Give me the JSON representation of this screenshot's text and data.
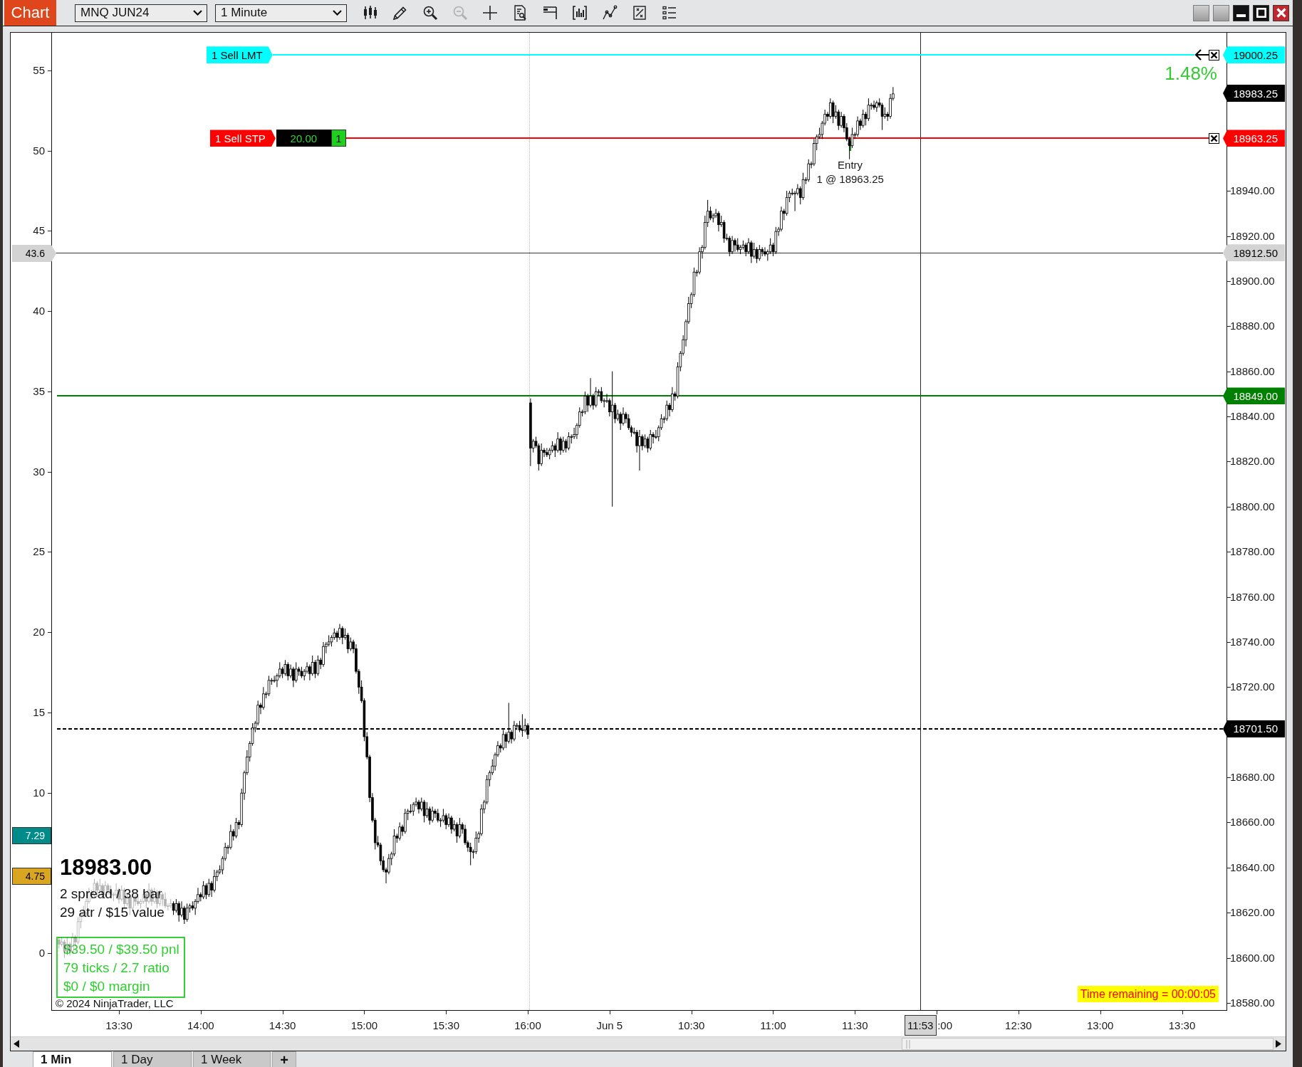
{
  "window": {
    "title": "Chart"
  },
  "toolbar": {
    "instrument": "MNQ JUN24",
    "interval": "1 Minute",
    "tools": [
      {
        "kind": "candles",
        "disabled": false
      },
      {
        "kind": "pencil",
        "disabled": false
      },
      {
        "kind": "zoom_in",
        "disabled": false
      },
      {
        "kind": "zoom_out",
        "disabled": true
      },
      {
        "kind": "crosshair",
        "disabled": false
      },
      {
        "kind": "document_search",
        "disabled": false
      },
      {
        "kind": "rows",
        "disabled": false
      },
      {
        "kind": "bar_chart",
        "disabled": false
      },
      {
        "kind": "line_chart",
        "disabled": false
      },
      {
        "kind": "square_chart",
        "disabled": false
      },
      {
        "kind": "list",
        "disabled": false
      }
    ]
  },
  "chart": {
    "chart_data": {
      "type": "candlestick",
      "ylim": [
        18576.5,
        19010.1
      ],
      "yticks": [
        {
          "value": 18940,
          "label": "18940.00"
        },
        {
          "value": 18920,
          "label": "18920.00"
        },
        {
          "value": 18900,
          "label": "18900.00"
        },
        {
          "value": 18880,
          "label": "18880.00"
        },
        {
          "value": 18860,
          "label": "18860.00"
        },
        {
          "value": 18840,
          "label": "18840.00"
        },
        {
          "value": 18820,
          "label": "18820.00"
        },
        {
          "value": 18800,
          "label": "18800.00"
        },
        {
          "value": 18780,
          "label": "18780.00"
        },
        {
          "value": 18760,
          "label": "18760.00"
        },
        {
          "value": 18740,
          "label": "18740.00"
        },
        {
          "value": 18720,
          "label": "18720.00"
        },
        {
          "value": 18680,
          "label": "18680.00"
        },
        {
          "value": 18660,
          "label": "18660.00"
        },
        {
          "value": 18640,
          "label": "18640.00"
        },
        {
          "value": 18620,
          "label": "18620.00"
        },
        {
          "value": 18600,
          "label": "18600.00"
        },
        {
          "value": 18580,
          "label": "18580.00"
        }
      ],
      "ref_lines": [
        {
          "axis": "y",
          "value": 19000.25,
          "color": "#00ffff"
        },
        {
          "axis": "y",
          "value": 18963.25,
          "color": "#ff0000"
        },
        {
          "axis": "y",
          "value": 18912.5,
          "color": "#3a3a3a"
        },
        {
          "axis": "y",
          "value": 18849,
          "color": "#008000"
        },
        {
          "axis": "y",
          "value": 18701.5,
          "color": "#000000"
        }
      ],
      "categories": [
        null,
        null,
        null,
        null,
        null,
        null,
        null,
        null,
        null,
        null,
        null,
        null,
        null,
        null,
        null,
        null,
        null,
        null,
        null,
        null,
        null,
        null,
        "13:30",
        null,
        null,
        null,
        null,
        null,
        null,
        null,
        null,
        null,
        null,
        null,
        null,
        null,
        null,
        null,
        null,
        null,
        null,
        null,
        null,
        null,
        null,
        null,
        null,
        null,
        null,
        null,
        null,
        null,
        "14:00",
        null,
        null,
        null,
        null,
        null,
        null,
        null,
        null,
        null,
        null,
        null,
        null,
        null,
        null,
        null,
        null,
        null,
        null,
        null,
        null,
        null,
        null,
        null,
        null,
        null,
        null,
        null,
        null,
        null,
        "14:30",
        null,
        null,
        null,
        null,
        null,
        null,
        null,
        null,
        null,
        null,
        null,
        null,
        null,
        null,
        null,
        null,
        null,
        null,
        null,
        null,
        null,
        null,
        null,
        null,
        null,
        null,
        null,
        null,
        null,
        "15:00",
        null,
        null,
        null,
        null,
        null,
        null,
        null,
        null,
        null,
        null,
        null,
        null,
        null,
        null,
        null,
        null,
        null,
        null,
        null,
        null,
        null,
        null,
        null,
        null,
        null,
        null,
        null,
        null,
        null,
        "15:30",
        null,
        null,
        null,
        null,
        null,
        null,
        null,
        null,
        null,
        null,
        null,
        null,
        null,
        null,
        null,
        null,
        null,
        null,
        null,
        null,
        null,
        null,
        null,
        null,
        null,
        null,
        null,
        null,
        null,
        "16:00",
        null,
        null,
        null,
        null,
        null,
        null,
        null,
        null,
        null,
        null,
        null,
        null,
        null,
        null,
        null,
        null,
        null,
        null,
        null,
        null,
        null,
        null,
        null,
        null,
        null,
        null,
        null,
        null,
        null,
        "Jun 5",
        null,
        null,
        null,
        null,
        null,
        null,
        null,
        null,
        null,
        null,
        null,
        null,
        null,
        null,
        null,
        null,
        null,
        null,
        null,
        null,
        null,
        null,
        null,
        null,
        null,
        null,
        null,
        null,
        null,
        "10:30",
        null,
        null,
        null,
        null,
        null,
        null,
        null,
        null,
        null,
        null,
        null,
        null,
        null,
        null,
        null,
        null,
        null,
        null,
        null,
        null,
        null,
        null,
        null,
        null,
        null,
        null,
        null,
        null,
        null,
        "11:00",
        null,
        null,
        null,
        null,
        null,
        null,
        null,
        null,
        null,
        null,
        null,
        null,
        null,
        null,
        null,
        null,
        null,
        null,
        null,
        null,
        null,
        null,
        null,
        null,
        null,
        null,
        null,
        null,
        null,
        "11:30",
        null,
        null,
        null,
        null,
        null,
        null,
        null,
        null,
        null,
        null,
        null,
        null,
        null,
        null,
        null,
        null,
        null,
        null,
        null,
        null,
        null,
        null,
        null,
        null,
        null,
        null,
        null,
        null,
        null,
        null,
        null,
        null,
        ":00",
        null,
        null,
        null,
        null,
        null,
        null,
        null,
        null,
        null,
        null,
        null,
        null,
        null,
        null,
        null,
        null,
        null,
        null,
        null,
        null,
        null,
        null,
        null,
        null,
        null,
        null,
        "12:30",
        null,
        null,
        null,
        null,
        null,
        null,
        null,
        null,
        null,
        null,
        null,
        null,
        null,
        null,
        null,
        null,
        null,
        null,
        null,
        null,
        null,
        null,
        null,
        null,
        null,
        null,
        null,
        null,
        null,
        "13:00",
        null,
        null,
        null,
        null,
        null,
        null,
        null,
        null,
        null,
        null,
        null,
        null,
        null,
        null,
        null,
        null,
        null,
        null,
        null,
        null,
        null,
        null,
        null,
        null,
        null,
        null,
        null,
        null,
        null,
        "13:30"
      ],
      "ohlc": [
        [
          18608,
          18609,
          18604,
          18606
        ],
        [
          18606,
          18609,
          18605,
          18607
        ],
        [
          18607,
          18608,
          18600,
          18603
        ],
        [
          18603,
          18609,
          18602,
          18606
        ],
        [
          18606,
          18607,
          18601,
          18603
        ],
        [
          18603,
          18611,
          18602,
          18609
        ],
        [
          18609,
          18610,
          18605,
          18607
        ],
        [
          18607,
          18618,
          18606,
          18616
        ],
        [
          18616,
          18620,
          18613,
          18619
        ],
        [
          18619,
          18623,
          18618,
          18620
        ],
        [
          18620,
          18626,
          18618,
          18625
        ],
        [
          18625,
          18631,
          18624,
          18629
        ],
        [
          18629,
          18630,
          18626,
          18628
        ],
        [
          18628,
          18635,
          18627,
          18633
        ],
        [
          18633,
          18634,
          18627,
          18630
        ],
        [
          18630,
          18635,
          18629,
          18632
        ],
        [
          18632,
          18633,
          18626,
          18628
        ],
        [
          18628,
          18634,
          18627,
          18632
        ],
        [
          18632,
          18633,
          18628,
          18630
        ],
        [
          18630,
          18632,
          18627,
          18628
        ],
        [
          18628,
          18629,
          18625,
          18628
        ],
        [
          18628,
          18633,
          18627,
          18630
        ],
        [
          18630,
          18631,
          18624,
          18626
        ],
        [
          18626,
          18632,
          18625,
          18630
        ],
        [
          18630,
          18631,
          18622,
          18624
        ],
        [
          18624,
          18629,
          18623,
          18627
        ],
        [
          18627,
          18628,
          18619,
          18622
        ],
        [
          18622,
          18630,
          18621,
          18627
        ],
        [
          18627,
          18628,
          18623,
          18625
        ],
        [
          18625,
          18627,
          18623,
          18624
        ],
        [
          18624,
          18626,
          18622,
          18625
        ],
        [
          18625,
          18630,
          18624,
          18628
        ],
        [
          18628,
          18629,
          18622,
          18625
        ],
        [
          18625,
          18633,
          18624,
          18630
        ],
        [
          18630,
          18631,
          18623,
          18625
        ],
        [
          18625,
          18631,
          18624,
          18629
        ],
        [
          18629,
          18630,
          18622,
          18624
        ],
        [
          18624,
          18630,
          18623,
          18628
        ],
        [
          18628,
          18629,
          18623,
          18626
        ],
        [
          18626,
          18629,
          18622,
          18623
        ],
        [
          18623,
          18624,
          18621,
          18623
        ],
        [
          18623,
          18626,
          18622,
          18624
        ],
        [
          18624,
          18625,
          18619,
          18621
        ],
        [
          18621,
          18626,
          18620,
          18624
        ],
        [
          18624,
          18625,
          18616,
          18619
        ],
        [
          18619,
          18625,
          18618,
          18622
        ],
        [
          18622,
          18623,
          18615,
          18617
        ],
        [
          18617,
          18624,
          18616,
          18622
        ],
        [
          18622,
          18624,
          18620,
          18623
        ],
        [
          18623,
          18625,
          18621,
          18622
        ],
        [
          18622,
          18626,
          18619,
          18625
        ],
        [
          18625,
          18631,
          18624,
          18628
        ],
        [
          18628,
          18629,
          18625,
          18627
        ],
        [
          18627,
          18634,
          18626,
          18632
        ],
        [
          18632,
          18633,
          18626,
          18628
        ],
        [
          18628,
          18635,
          18627,
          18633
        ],
        [
          18633,
          18634,
          18627,
          18630
        ],
        [
          18630,
          18639,
          18629,
          18636
        ],
        [
          18636,
          18639,
          18634,
          18638
        ],
        [
          18638,
          18641,
          18637,
          18639
        ],
        [
          18639,
          18645,
          18637,
          18644
        ],
        [
          18644,
          18651,
          18643,
          18649
        ],
        [
          18649,
          18650,
          18646,
          18649
        ],
        [
          18649,
          18659,
          18648,
          18656
        ],
        [
          18656,
          18657,
          18652,
          18654
        ],
        [
          18654,
          18662,
          18653,
          18660
        ],
        [
          18660,
          18661,
          18657,
          18659
        ],
        [
          18659,
          18675,
          18658,
          18673
        ],
        [
          18673,
          18683,
          18670,
          18682
        ],
        [
          18682,
          18692,
          18681,
          18689
        ],
        [
          18689,
          18696,
          18687,
          18695
        ],
        [
          18695,
          18704,
          18694,
          18702
        ],
        [
          18702,
          18705,
          18700,
          18704
        ],
        [
          18704,
          18714,
          18703,
          18712
        ],
        [
          18712,
          18713,
          18708,
          18711
        ],
        [
          18711,
          18720,
          18710,
          18717
        ],
        [
          18717,
          18718,
          18715,
          18717
        ],
        [
          18717,
          18725,
          18716,
          18723
        ],
        [
          18723,
          18724,
          18721,
          18723
        ],
        [
          18723,
          18725,
          18722,
          18723
        ],
        [
          18723,
          18726,
          18720,
          18725
        ],
        [
          18725,
          18731,
          18724,
          18728
        ],
        [
          18728,
          18729,
          18724,
          18726
        ],
        [
          18726,
          18732,
          18725,
          18730
        ],
        [
          18730,
          18731,
          18723,
          18725
        ],
        [
          18725,
          18730,
          18724,
          18728
        ],
        [
          18728,
          18729,
          18720,
          18723
        ],
        [
          18723,
          18731,
          18722,
          18728
        ],
        [
          18728,
          18729,
          18725,
          18727
        ],
        [
          18727,
          18729,
          18724,
          18725
        ],
        [
          18725,
          18728,
          18723,
          18727
        ],
        [
          18727,
          18731,
          18726,
          18729
        ],
        [
          18729,
          18730,
          18723,
          18726
        ],
        [
          18726,
          18734,
          18725,
          18731
        ],
        [
          18731,
          18732,
          18724,
          18726
        ],
        [
          18726,
          18734,
          18725,
          18732
        ],
        [
          18732,
          18733,
          18728,
          18730
        ],
        [
          18730,
          18740,
          18729,
          18738
        ],
        [
          18738,
          18740,
          18735,
          18739
        ],
        [
          18739,
          18743,
          18738,
          18740
        ],
        [
          18740,
          18743,
          18738,
          18742
        ],
        [
          18742,
          18746,
          18741,
          18744
        ],
        [
          18744,
          18745,
          18740,
          18742
        ],
        [
          18742,
          18748,
          18741,
          18746
        ],
        [
          18746,
          18747,
          18739,
          18742
        ],
        [
          18742,
          18746,
          18741,
          18743
        ],
        [
          18743,
          18744,
          18735,
          18737
        ],
        [
          18737,
          18742,
          18736,
          18740
        ],
        [
          18740,
          18741,
          18735,
          18737
        ],
        [
          18737,
          18739,
          18726,
          18727
        ],
        [
          18727,
          18728,
          18717,
          18720
        ],
        [
          18720,
          18723,
          18713,
          18714
        ],
        [
          18714,
          18715,
          18696,
          18698
        ],
        [
          18698,
          18700,
          18688,
          18689
        ],
        [
          18689,
          18690,
          18669,
          18671
        ],
        [
          18671,
          18673,
          18660,
          18661
        ],
        [
          18661,
          18662,
          18648,
          18651
        ],
        [
          18651,
          18654,
          18649,
          18650
        ],
        [
          18650,
          18651,
          18641,
          18643
        ],
        [
          18643,
          18645,
          18638,
          18639
        ],
        [
          18639,
          18640,
          18633,
          18638
        ],
        [
          18638,
          18646,
          18637,
          18644
        ],
        [
          18644,
          18647,
          18641,
          18646
        ],
        [
          18646,
          18657,
          18645,
          18654
        ],
        [
          18654,
          18655,
          18651,
          18653
        ],
        [
          18653,
          18660,
          18652,
          18658
        ],
        [
          18658,
          18659,
          18654,
          18656
        ],
        [
          18656,
          18666,
          18655,
          18664
        ],
        [
          18664,
          18666,
          18661,
          18665
        ],
        [
          18665,
          18668,
          18664,
          18665
        ],
        [
          18665,
          18669,
          18663,
          18668
        ],
        [
          18668,
          18671,
          18667,
          18669
        ],
        [
          18669,
          18670,
          18664,
          18666
        ],
        [
          18666,
          18671,
          18665,
          18669
        ],
        [
          18669,
          18670,
          18660,
          18663
        ],
        [
          18663,
          18669,
          18662,
          18666
        ],
        [
          18666,
          18667,
          18659,
          18661
        ],
        [
          18661,
          18667,
          18660,
          18665
        ],
        [
          18665,
          18666,
          18662,
          18664
        ],
        [
          18664,
          18666,
          18660,
          18661
        ],
        [
          18661,
          18662,
          18658,
          18661
        ],
        [
          18661,
          18666,
          18660,
          18663
        ],
        [
          18663,
          18664,
          18657,
          18659
        ],
        [
          18659,
          18664,
          18658,
          18662
        ],
        [
          18662,
          18663,
          18655,
          18657
        ],
        [
          18657,
          18661,
          18656,
          18659
        ],
        [
          18659,
          18660,
          18651,
          18654
        ],
        [
          18654,
          18662,
          18653,
          18659
        ],
        [
          18659,
          18660,
          18655,
          18657
        ],
        [
          18657,
          18659,
          18650,
          18651
        ],
        [
          18651,
          18652,
          18647,
          18649
        ],
        [
          18649,
          18651,
          18641,
          18647
        ],
        [
          18647,
          18648,
          18644,
          18647
        ],
        [
          18647,
          18656,
          18646,
          18653
        ],
        [
          18653,
          18656,
          18651,
          18655
        ],
        [
          18655,
          18668,
          18654,
          18666
        ],
        [
          18666,
          18670,
          18664,
          18669
        ],
        [
          18669,
          18681,
          18668,
          18679
        ],
        [
          18679,
          18683,
          18676,
          18682
        ],
        [
          18682,
          18688,
          18681,
          18685
        ],
        [
          18685,
          18691,
          18683,
          18690
        ],
        [
          18690,
          18696,
          18689,
          18694
        ],
        [
          18694,
          18695,
          18691,
          18693
        ],
        [
          18693,
          18701,
          18692,
          18699
        ],
        [
          18699,
          18700,
          18693,
          18696
        ],
        [
          18696,
          18713,
          18695,
          18700
        ],
        [
          18700,
          18701,
          18695,
          18697
        ],
        [
          18697,
          18705,
          18696,
          18703
        ],
        [
          18703,
          18704,
          18701,
          18703
        ],
        [
          18703,
          18705,
          18700,
          18701
        ],
        [
          18701,
          18708,
          18698,
          18701
        ],
        [
          18701,
          18706,
          18700,
          18703
        ],
        [
          18703,
          18704,
          18697,
          18699
        ],
        [
          18846,
          18848,
          18818,
          18826
        ],
        [
          18826,
          18830,
          18824,
          18829
        ],
        [
          18829,
          18831,
          18826,
          18827
        ],
        [
          18827,
          18828,
          18816,
          18819
        ],
        [
          18819,
          18828,
          18818,
          18825
        ],
        [
          18825,
          18826,
          18822,
          18824
        ],
        [
          18824,
          18826,
          18822,
          18823
        ],
        [
          18823,
          18826,
          18821,
          18825
        ],
        [
          18825,
          18829,
          18824,
          18827
        ],
        [
          18827,
          18828,
          18822,
          18825
        ],
        [
          18825,
          18833,
          18824,
          18830
        ],
        [
          18830,
          18831,
          18823,
          18825
        ],
        [
          18825,
          18831,
          18824,
          18829
        ],
        [
          18829,
          18830,
          18824,
          18826
        ],
        [
          18826,
          18833,
          18825,
          18831
        ],
        [
          18831,
          18832,
          18828,
          18831
        ],
        [
          18831,
          18835,
          18830,
          18832
        ],
        [
          18832,
          18837,
          18830,
          18836
        ],
        [
          18836,
          18844,
          18835,
          18842
        ],
        [
          18842,
          18843,
          18840,
          18842
        ],
        [
          18842,
          18851,
          18841,
          18849
        ],
        [
          18849,
          18850,
          18842,
          18845
        ],
        [
          18845,
          18857,
          18844,
          18849
        ],
        [
          18849,
          18850,
          18843,
          18845
        ],
        [
          18845,
          18853,
          18844,
          18851
        ],
        [
          18851,
          18852,
          18849,
          18851
        ],
        [
          18851,
          18853,
          18846,
          18847
        ],
        [
          18847,
          18848,
          18844,
          18847
        ],
        [
          18847,
          18850,
          18846,
          18847
        ],
        [
          18847,
          18848,
          18840,
          18842
        ],
        [
          18842,
          18860,
          18800,
          18845
        ],
        [
          18845,
          18846,
          18837,
          18839
        ],
        [
          18839,
          18843,
          18838,
          18841
        ],
        [
          18841,
          18842,
          18834,
          18837
        ],
        [
          18837,
          18844,
          18836,
          18841
        ],
        [
          18841,
          18842,
          18837,
          18839
        ],
        [
          18839,
          18841,
          18834,
          18835
        ],
        [
          18835,
          18836,
          18831,
          18833
        ],
        [
          18833,
          18835,
          18832,
          18833
        ],
        [
          18833,
          18834,
          18824,
          18827
        ],
        [
          18827,
          18834,
          18816,
          18831
        ],
        [
          18831,
          18832,
          18825,
          18827
        ],
        [
          18827,
          18832,
          18826,
          18830
        ],
        [
          18830,
          18831,
          18824,
          18826
        ],
        [
          18826,
          18834,
          18825,
          18832
        ],
        [
          18832,
          18833,
          18828,
          18831
        ],
        [
          18831,
          18834,
          18830,
          18831
        ],
        [
          18831,
          18836,
          18829,
          18835
        ],
        [
          18835,
          18841,
          18834,
          18839
        ],
        [
          18839,
          18840,
          18837,
          18839
        ],
        [
          18839,
          18847,
          18838,
          18845
        ],
        [
          18845,
          18846,
          18840,
          18843
        ],
        [
          18843,
          18853,
          18842,
          18850
        ],
        [
          18850,
          18851,
          18847,
          18849
        ],
        [
          18849,
          18864,
          18848,
          18862
        ],
        [
          18862,
          18869,
          18860,
          18868
        ],
        [
          18868,
          18876,
          18867,
          18874
        ],
        [
          18874,
          18883,
          18871,
          18882
        ],
        [
          18882,
          18893,
          18881,
          18890
        ],
        [
          18890,
          18895,
          18888,
          18894
        ],
        [
          18894,
          18906,
          18893,
          18904
        ],
        [
          18904,
          18905,
          18902,
          18904
        ],
        [
          18904,
          18915,
          18903,
          18913
        ],
        [
          18913,
          18916,
          18910,
          18915
        ],
        [
          18915,
          18929,
          18914,
          18926
        ],
        [
          18926,
          18936,
          18924,
          18931
        ],
        [
          18931,
          18933,
          18927,
          18928
        ],
        [
          18928,
          18930,
          18926,
          18929
        ],
        [
          18929,
          18932,
          18928,
          18930
        ],
        [
          18930,
          18931,
          18922,
          18925
        ],
        [
          18925,
          18929,
          18924,
          18926
        ],
        [
          18926,
          18927,
          18917,
          18919
        ],
        [
          18919,
          18921,
          18918,
          18919
        ],
        [
          18919,
          18920,
          18911,
          18913
        ],
        [
          18913,
          18920,
          18912,
          18918
        ],
        [
          18918,
          18919,
          18913,
          18916
        ],
        [
          18916,
          18919,
          18913,
          18914
        ],
        [
          18914,
          18916,
          18912,
          18915
        ],
        [
          18915,
          18918,
          18914,
          18916
        ],
        [
          18916,
          18917,
          18911,
          18913
        ],
        [
          18913,
          18919,
          18912,
          18917
        ],
        [
          18917,
          18918,
          18908,
          18911
        ],
        [
          18911,
          18917,
          18910,
          18914
        ],
        [
          18914,
          18915,
          18908,
          18910
        ],
        [
          18910,
          18916,
          18909,
          18914
        ],
        [
          18914,
          18915,
          18911,
          18913
        ],
        [
          18913,
          18915,
          18911,
          18912
        ],
        [
          18912,
          18914,
          18909,
          18913
        ],
        [
          18913,
          18919,
          18912,
          18916
        ],
        [
          18916,
          18917,
          18911,
          18913
        ],
        [
          18913,
          18924,
          18912,
          18922
        ],
        [
          18922,
          18924,
          18920,
          18923
        ],
        [
          18923,
          18933,
          18922,
          18931
        ],
        [
          18931,
          18932,
          18927,
          18930
        ],
        [
          18930,
          18940,
          18929,
          18937
        ],
        [
          18937,
          18940,
          18935,
          18939
        ],
        [
          18939,
          18941,
          18938,
          18939
        ],
        [
          18939,
          18940,
          18931,
          18939
        ],
        [
          18939,
          18943,
          18938,
          18941
        ],
        [
          18941,
          18942,
          18934,
          18937
        ],
        [
          18937,
          18948,
          18936,
          18945
        ],
        [
          18945,
          18946,
          18943,
          18945
        ],
        [
          18945,
          18954,
          18944,
          18952
        ],
        [
          18952,
          18953,
          18950,
          18952
        ],
        [
          18952,
          18963,
          18951,
          18961
        ],
        [
          18961,
          18965,
          18958,
          18964
        ],
        [
          18964,
          18968,
          18963,
          18965
        ],
        [
          18965,
          18971,
          18963,
          18970
        ],
        [
          18970,
          18976,
          18969,
          18974
        ],
        [
          18974,
          18975,
          18971,
          18973
        ],
        [
          18973,
          18981,
          18972,
          18979
        ],
        [
          18979,
          18980,
          18970,
          18973
        ],
        [
          18973,
          18978,
          18972,
          18975
        ],
        [
          18975,
          18976,
          18967,
          18969
        ],
        [
          18969,
          18975,
          18968,
          18973
        ],
        [
          18973,
          18974,
          18966,
          18968
        ],
        [
          18968,
          18970,
          18962,
          18963
        ],
        [
          18963,
          18964,
          18954,
          18960
        ],
        [
          18960,
          18968,
          18959,
          18965
        ],
        [
          18965,
          18966,
          18963,
          18965
        ],
        [
          18965,
          18973,
          18964,
          18971
        ],
        [
          18971,
          18972,
          18967,
          18969
        ],
        [
          18969,
          18976,
          18968,
          18974
        ],
        [
          18974,
          18975,
          18969,
          18972
        ],
        [
          18972,
          18981,
          18971,
          18978
        ],
        [
          18978,
          18979,
          18976,
          18978
        ],
        [
          18978,
          18980,
          18976,
          18977
        ],
        [
          18977,
          18980,
          18975,
          18979
        ],
        [
          18979,
          18981,
          18977,
          18978
        ],
        [
          18978,
          18979,
          18967,
          18973
        ],
        [
          18973,
          18977,
          18972,
          18974
        ],
        [
          18974,
          18975,
          18971,
          18973
        ],
        [
          18973,
          18983,
          18972,
          18981
        ],
        [
          18981,
          18986,
          18980,
          18983
        ],
        null,
        null,
        null,
        null,
        null,
        null,
        null,
        null,
        null,
        null,
        null,
        null,
        null,
        null,
        null,
        null,
        null,
        null,
        null,
        null,
        null,
        null,
        null,
        null,
        null,
        null,
        null,
        null,
        null,
        null,
        null,
        null,
        null,
        null,
        null,
        null,
        null,
        null,
        null,
        null,
        null,
        null,
        null,
        null,
        null,
        null,
        null,
        null,
        null,
        null,
        null,
        null,
        null,
        null,
        null,
        null,
        null,
        null,
        null,
        null,
        null,
        null,
        null,
        null,
        null,
        null,
        null,
        null,
        null,
        null,
        null,
        null,
        null,
        null,
        null,
        null,
        null,
        null,
        null,
        null,
        null,
        null,
        null,
        null,
        null,
        null,
        null,
        null,
        null,
        null,
        null,
        null,
        null,
        null,
        null,
        null,
        null,
        null,
        null,
        null,
        null,
        null,
        null,
        null,
        null,
        null
      ]
    },
    "orders": [
      {
        "kind": "limit",
        "label": "1 Sell LMT"
      },
      {
        "kind": "stop",
        "label": "1 Sell STP",
        "distance": "20.00",
        "quantity": "1"
      }
    ],
    "percent_readout": "1.48%",
    "entry": {
      "label": "Entry",
      "detail": "1 @ 18963.25"
    },
    "left_axis": {
      "ticks": [
        "55",
        "50",
        "45",
        "40",
        "35",
        "30",
        "25",
        "20",
        "15",
        "10",
        "0"
      ],
      "markers": [
        {
          "kind": "crosshair",
          "label": "43.6",
          "color": "#d3d3d3"
        },
        {
          "kind": "indicator",
          "label": "7.29",
          "color": "#008b8b"
        },
        {
          "kind": "indicator",
          "label": "4.75",
          "color": "#daa520"
        }
      ]
    },
    "right_axis": {
      "markers": [
        {
          "label": "19000.25",
          "color": "#00ffff"
        },
        {
          "label": "18983.25",
          "color": "#000000"
        },
        {
          "label": "18963.25",
          "color": "#ff0000"
        },
        {
          "label": "18912.50",
          "color": "#d3d3d3"
        },
        {
          "label": "18849.00",
          "color": "#008000"
        },
        {
          "label": "18701.50",
          "color": "#000000"
        }
      ]
    },
    "info": {
      "last_price": "18983.00",
      "lines": [
        "2 spread / 38 bar",
        "29 atr / $15 value"
      ]
    },
    "pnl": [
      "$39.50 / $39.50 pnl",
      "79 ticks / 2.7 ratio",
      "$0 / $0 margin"
    ],
    "copyright": "© 2024 NinjaTrader, LLC",
    "timer": "Time remaining = 00:00:05",
    "x_axis": {
      "cursor_time": "11:53"
    }
  },
  "tabs": [
    {
      "label": "1 Min",
      "selected": true
    },
    {
      "label": "1 Day",
      "selected": false
    },
    {
      "label": "1 Week",
      "selected": false
    }
  ],
  "add_tab": "+"
}
